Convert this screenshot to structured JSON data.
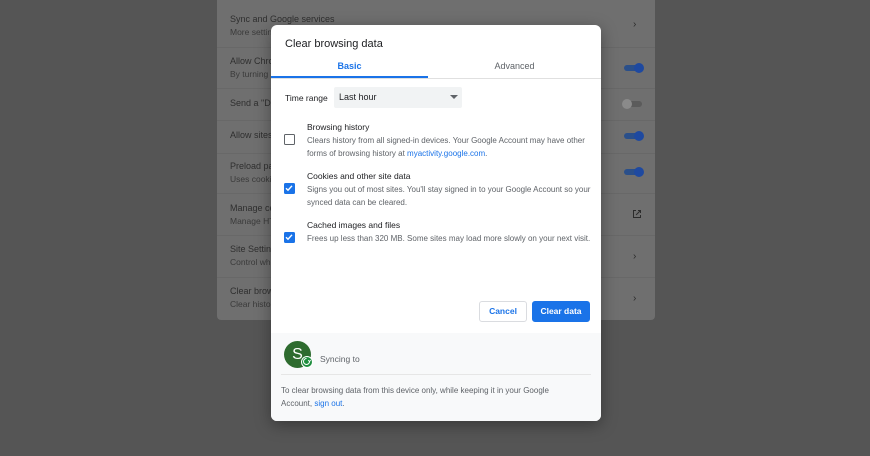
{
  "settings": {
    "rows": [
      {
        "title": "Sync and Google services",
        "sub": "More settin",
        "control": "chevron"
      },
      {
        "title": "Allow Chro",
        "sub": "By turning",
        "control": "toggle-on"
      },
      {
        "title": "Send a \"Do",
        "sub": "",
        "control": "toggle-off"
      },
      {
        "title": "Allow sites",
        "sub": "",
        "control": "toggle-on"
      },
      {
        "title": "Preload pa",
        "sub": "Uses cooki",
        "control": "toggle-on"
      },
      {
        "title": "Manage ce",
        "sub": "Manage HT",
        "control": "external"
      },
      {
        "title": "Site Setting",
        "sub": "Control wh",
        "control": "chevron"
      },
      {
        "title": "Clear brow",
        "sub": "Clear histo",
        "control": "chevron"
      }
    ]
  },
  "dialog": {
    "title": "Clear browsing data",
    "tabs": {
      "basic": "Basic",
      "advanced": "Advanced"
    },
    "time_range": {
      "label": "Time range",
      "value": "Last hour"
    },
    "options": [
      {
        "title": "Browsing history",
        "desc": "Clears history from all signed-in devices. Your Google Account may have other forms of browsing history at ",
        "link": "myactivity.google.com",
        "desc_after": ".",
        "checked": false
      },
      {
        "title": "Cookies and other site data",
        "desc": "Signs you out of most sites. You'll stay signed in to your Google Account so your synced data can be cleared.",
        "checked": true
      },
      {
        "title": "Cached images and files",
        "desc": "Frees up less than 320 MB. Some sites may load more slowly on your next visit.",
        "checked": true
      }
    ],
    "buttons": {
      "cancel": "Cancel",
      "clear": "Clear data"
    },
    "sync": {
      "avatar_letter": "S",
      "text": "Syncing to"
    },
    "footer": {
      "text": "To clear browsing data from this device only, while keeping it in your Google Account, ",
      "link": "sign out",
      "after": "."
    }
  },
  "colors": {
    "accent": "#1a73e8",
    "avatar": "#2e6b2f",
    "sync_badge": "#1e8e3e"
  }
}
